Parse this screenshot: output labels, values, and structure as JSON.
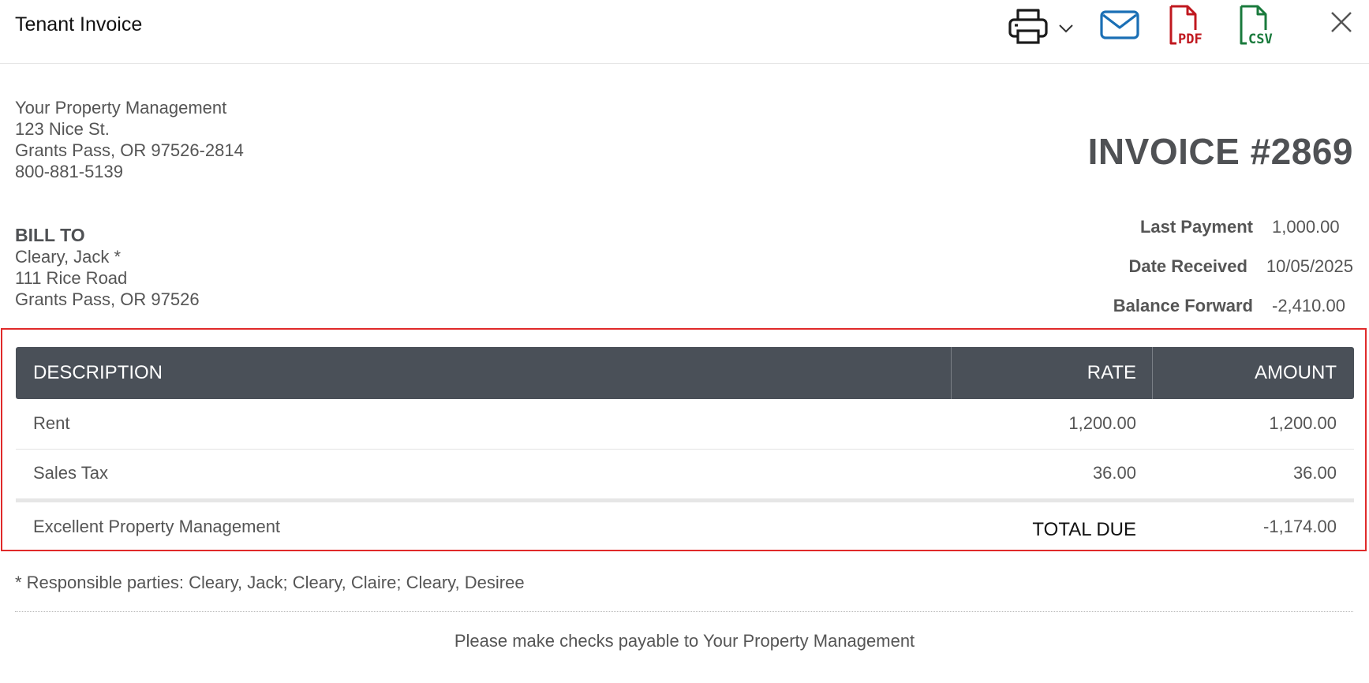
{
  "header": {
    "title": "Tenant Invoice",
    "icons": [
      "printer-icon",
      "chevron-down-icon",
      "mail-icon",
      "pdf-icon",
      "csv-icon",
      "close-icon"
    ],
    "pdf_label": "PDF",
    "csv_label": "CSV"
  },
  "colors": {
    "mail": "#1a6fb5",
    "pdf": "#c0181f",
    "csv": "#1a7a3c",
    "table_header": "#4a5058",
    "highlight_border": "#e02a2a"
  },
  "company": {
    "name": "Your Property Management",
    "street": "123 Nice St.",
    "city_line": "Grants Pass, OR 97526-2814",
    "phone": "800-881-5139"
  },
  "invoice": {
    "number": "INVOICE #2869"
  },
  "bill_to": {
    "heading": "BILL TO",
    "name": "Cleary, Jack *",
    "street": "111 Rice Road",
    "city_line": "Grants Pass, OR 97526"
  },
  "summary": [
    {
      "label": "Last Payment",
      "value": "1,000.00"
    },
    {
      "label": "Date Received",
      "value": "10/05/2025"
    },
    {
      "label": "Balance Forward",
      "value": "-2,410.00"
    }
  ],
  "table": {
    "headers": {
      "description": "DESCRIPTION",
      "rate": "RATE",
      "amount": "AMOUNT"
    },
    "rows": [
      {
        "description": "Rent",
        "rate": "1,200.00",
        "amount": "1,200.00"
      },
      {
        "description": "Sales Tax",
        "rate": "36.00",
        "amount": "36.00"
      }
    ],
    "total": {
      "description": "Excellent Property Management",
      "label": "TOTAL DUE",
      "amount": "-1,174.00"
    }
  },
  "note": "* Responsible parties: Cleary, Jack; Cleary, Claire; Cleary, Desiree",
  "footer": "Please make checks payable to Your Property Management"
}
